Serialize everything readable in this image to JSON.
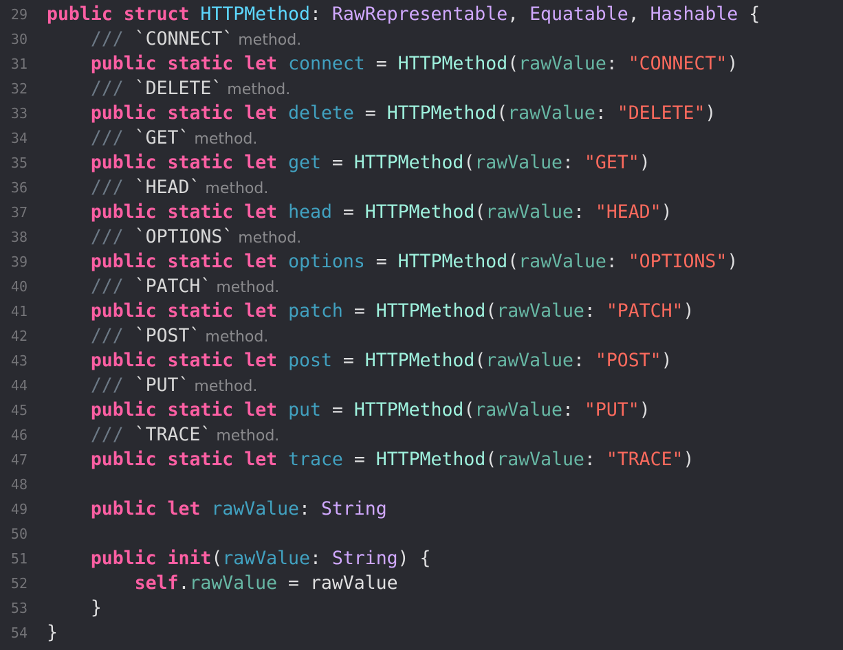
{
  "editor": {
    "background": "#292a30",
    "colors": {
      "keyword": "#fc5fa3",
      "type_declaration": "#5dd8ff",
      "type": "#d0a8ff",
      "project_type": "#9ef1dd",
      "project_member": "#67b7a4",
      "declaration": "#41a1c0",
      "string": "#fc6a5d",
      "plain": "#dfdfe0",
      "comment": "#6c7986",
      "line_number": "#747478"
    },
    "lines": [
      {
        "num": "29",
        "tokens": [
          {
            "t": "public",
            "c": "kw"
          },
          {
            "t": " ",
            "c": "plain"
          },
          {
            "t": "struct",
            "c": "kw"
          },
          {
            "t": " ",
            "c": "plain"
          },
          {
            "t": "HTTPMethod",
            "c": "typeDecl"
          },
          {
            "t": ": ",
            "c": "plain"
          },
          {
            "t": "RawRepresentable",
            "c": "type"
          },
          {
            "t": ", ",
            "c": "plain"
          },
          {
            "t": "Equatable",
            "c": "type"
          },
          {
            "t": ", ",
            "c": "plain"
          },
          {
            "t": "Hashable",
            "c": "type"
          },
          {
            "t": " {",
            "c": "plain"
          }
        ]
      },
      {
        "num": "30",
        "tokens": [
          {
            "t": "    ",
            "c": "plain"
          },
          {
            "t": "/// ",
            "c": "cmt"
          },
          {
            "t": "`CONNECT`",
            "c": "cmtcode"
          },
          {
            "t": " method.",
            "c": "cmttext"
          }
        ]
      },
      {
        "num": "31",
        "tokens": [
          {
            "t": "    ",
            "c": "plain"
          },
          {
            "t": "public",
            "c": "kw"
          },
          {
            "t": " ",
            "c": "plain"
          },
          {
            "t": "static",
            "c": "kw"
          },
          {
            "t": " ",
            "c": "plain"
          },
          {
            "t": "let",
            "c": "kw"
          },
          {
            "t": " ",
            "c": "plain"
          },
          {
            "t": "connect",
            "c": "declName"
          },
          {
            "t": " = ",
            "c": "plain"
          },
          {
            "t": "HTTPMethod",
            "c": "projType"
          },
          {
            "t": "(",
            "c": "plain"
          },
          {
            "t": "rawValue",
            "c": "projMember"
          },
          {
            "t": ": ",
            "c": "plain"
          },
          {
            "t": "\"CONNECT\"",
            "c": "str"
          },
          {
            "t": ")",
            "c": "plain"
          }
        ]
      },
      {
        "num": "32",
        "tokens": [
          {
            "t": "    ",
            "c": "plain"
          },
          {
            "t": "/// ",
            "c": "cmt"
          },
          {
            "t": "`DELETE`",
            "c": "cmtcode"
          },
          {
            "t": " method.",
            "c": "cmttext"
          }
        ]
      },
      {
        "num": "33",
        "tokens": [
          {
            "t": "    ",
            "c": "plain"
          },
          {
            "t": "public",
            "c": "kw"
          },
          {
            "t": " ",
            "c": "plain"
          },
          {
            "t": "static",
            "c": "kw"
          },
          {
            "t": " ",
            "c": "plain"
          },
          {
            "t": "let",
            "c": "kw"
          },
          {
            "t": " ",
            "c": "plain"
          },
          {
            "t": "delete",
            "c": "declName"
          },
          {
            "t": " = ",
            "c": "plain"
          },
          {
            "t": "HTTPMethod",
            "c": "projType"
          },
          {
            "t": "(",
            "c": "plain"
          },
          {
            "t": "rawValue",
            "c": "projMember"
          },
          {
            "t": ": ",
            "c": "plain"
          },
          {
            "t": "\"DELETE\"",
            "c": "str"
          },
          {
            "t": ")",
            "c": "plain"
          }
        ]
      },
      {
        "num": "34",
        "tokens": [
          {
            "t": "    ",
            "c": "plain"
          },
          {
            "t": "/// ",
            "c": "cmt"
          },
          {
            "t": "`GET`",
            "c": "cmtcode"
          },
          {
            "t": " method.",
            "c": "cmttext"
          }
        ]
      },
      {
        "num": "35",
        "tokens": [
          {
            "t": "    ",
            "c": "plain"
          },
          {
            "t": "public",
            "c": "kw"
          },
          {
            "t": " ",
            "c": "plain"
          },
          {
            "t": "static",
            "c": "kw"
          },
          {
            "t": " ",
            "c": "plain"
          },
          {
            "t": "let",
            "c": "kw"
          },
          {
            "t": " ",
            "c": "plain"
          },
          {
            "t": "get",
            "c": "declName"
          },
          {
            "t": " = ",
            "c": "plain"
          },
          {
            "t": "HTTPMethod",
            "c": "projType"
          },
          {
            "t": "(",
            "c": "plain"
          },
          {
            "t": "rawValue",
            "c": "projMember"
          },
          {
            "t": ": ",
            "c": "plain"
          },
          {
            "t": "\"GET\"",
            "c": "str"
          },
          {
            "t": ")",
            "c": "plain"
          }
        ]
      },
      {
        "num": "36",
        "tokens": [
          {
            "t": "    ",
            "c": "plain"
          },
          {
            "t": "/// ",
            "c": "cmt"
          },
          {
            "t": "`HEAD`",
            "c": "cmtcode"
          },
          {
            "t": " method.",
            "c": "cmttext"
          }
        ]
      },
      {
        "num": "37",
        "tokens": [
          {
            "t": "    ",
            "c": "plain"
          },
          {
            "t": "public",
            "c": "kw"
          },
          {
            "t": " ",
            "c": "plain"
          },
          {
            "t": "static",
            "c": "kw"
          },
          {
            "t": " ",
            "c": "plain"
          },
          {
            "t": "let",
            "c": "kw"
          },
          {
            "t": " ",
            "c": "plain"
          },
          {
            "t": "head",
            "c": "declName"
          },
          {
            "t": " = ",
            "c": "plain"
          },
          {
            "t": "HTTPMethod",
            "c": "projType"
          },
          {
            "t": "(",
            "c": "plain"
          },
          {
            "t": "rawValue",
            "c": "projMember"
          },
          {
            "t": ": ",
            "c": "plain"
          },
          {
            "t": "\"HEAD\"",
            "c": "str"
          },
          {
            "t": ")",
            "c": "plain"
          }
        ]
      },
      {
        "num": "38",
        "tokens": [
          {
            "t": "    ",
            "c": "plain"
          },
          {
            "t": "/// ",
            "c": "cmt"
          },
          {
            "t": "`OPTIONS`",
            "c": "cmtcode"
          },
          {
            "t": " method.",
            "c": "cmttext"
          }
        ]
      },
      {
        "num": "39",
        "tokens": [
          {
            "t": "    ",
            "c": "plain"
          },
          {
            "t": "public",
            "c": "kw"
          },
          {
            "t": " ",
            "c": "plain"
          },
          {
            "t": "static",
            "c": "kw"
          },
          {
            "t": " ",
            "c": "plain"
          },
          {
            "t": "let",
            "c": "kw"
          },
          {
            "t": " ",
            "c": "plain"
          },
          {
            "t": "options",
            "c": "declName"
          },
          {
            "t": " = ",
            "c": "plain"
          },
          {
            "t": "HTTPMethod",
            "c": "projType"
          },
          {
            "t": "(",
            "c": "plain"
          },
          {
            "t": "rawValue",
            "c": "projMember"
          },
          {
            "t": ": ",
            "c": "plain"
          },
          {
            "t": "\"OPTIONS\"",
            "c": "str"
          },
          {
            "t": ")",
            "c": "plain"
          }
        ]
      },
      {
        "num": "40",
        "tokens": [
          {
            "t": "    ",
            "c": "plain"
          },
          {
            "t": "/// ",
            "c": "cmt"
          },
          {
            "t": "`PATCH`",
            "c": "cmtcode"
          },
          {
            "t": " method.",
            "c": "cmttext"
          }
        ]
      },
      {
        "num": "41",
        "tokens": [
          {
            "t": "    ",
            "c": "plain"
          },
          {
            "t": "public",
            "c": "kw"
          },
          {
            "t": " ",
            "c": "plain"
          },
          {
            "t": "static",
            "c": "kw"
          },
          {
            "t": " ",
            "c": "plain"
          },
          {
            "t": "let",
            "c": "kw"
          },
          {
            "t": " ",
            "c": "plain"
          },
          {
            "t": "patch",
            "c": "declName"
          },
          {
            "t": " = ",
            "c": "plain"
          },
          {
            "t": "HTTPMethod",
            "c": "projType"
          },
          {
            "t": "(",
            "c": "plain"
          },
          {
            "t": "rawValue",
            "c": "projMember"
          },
          {
            "t": ": ",
            "c": "plain"
          },
          {
            "t": "\"PATCH\"",
            "c": "str"
          },
          {
            "t": ")",
            "c": "plain"
          }
        ]
      },
      {
        "num": "42",
        "tokens": [
          {
            "t": "    ",
            "c": "plain"
          },
          {
            "t": "/// ",
            "c": "cmt"
          },
          {
            "t": "`POST`",
            "c": "cmtcode"
          },
          {
            "t": " method.",
            "c": "cmttext"
          }
        ]
      },
      {
        "num": "43",
        "tokens": [
          {
            "t": "    ",
            "c": "plain"
          },
          {
            "t": "public",
            "c": "kw"
          },
          {
            "t": " ",
            "c": "plain"
          },
          {
            "t": "static",
            "c": "kw"
          },
          {
            "t": " ",
            "c": "plain"
          },
          {
            "t": "let",
            "c": "kw"
          },
          {
            "t": " ",
            "c": "plain"
          },
          {
            "t": "post",
            "c": "declName"
          },
          {
            "t": " = ",
            "c": "plain"
          },
          {
            "t": "HTTPMethod",
            "c": "projType"
          },
          {
            "t": "(",
            "c": "plain"
          },
          {
            "t": "rawValue",
            "c": "projMember"
          },
          {
            "t": ": ",
            "c": "plain"
          },
          {
            "t": "\"POST\"",
            "c": "str"
          },
          {
            "t": ")",
            "c": "plain"
          }
        ]
      },
      {
        "num": "44",
        "tokens": [
          {
            "t": "    ",
            "c": "plain"
          },
          {
            "t": "/// ",
            "c": "cmt"
          },
          {
            "t": "`PUT`",
            "c": "cmtcode"
          },
          {
            "t": " method.",
            "c": "cmttext"
          }
        ]
      },
      {
        "num": "45",
        "tokens": [
          {
            "t": "    ",
            "c": "plain"
          },
          {
            "t": "public",
            "c": "kw"
          },
          {
            "t": " ",
            "c": "plain"
          },
          {
            "t": "static",
            "c": "kw"
          },
          {
            "t": " ",
            "c": "plain"
          },
          {
            "t": "let",
            "c": "kw"
          },
          {
            "t": " ",
            "c": "plain"
          },
          {
            "t": "put",
            "c": "declName"
          },
          {
            "t": " = ",
            "c": "plain"
          },
          {
            "t": "HTTPMethod",
            "c": "projType"
          },
          {
            "t": "(",
            "c": "plain"
          },
          {
            "t": "rawValue",
            "c": "projMember"
          },
          {
            "t": ": ",
            "c": "plain"
          },
          {
            "t": "\"PUT\"",
            "c": "str"
          },
          {
            "t": ")",
            "c": "plain"
          }
        ]
      },
      {
        "num": "46",
        "tokens": [
          {
            "t": "    ",
            "c": "plain"
          },
          {
            "t": "/// ",
            "c": "cmt"
          },
          {
            "t": "`TRACE`",
            "c": "cmtcode"
          },
          {
            "t": " method.",
            "c": "cmttext"
          }
        ]
      },
      {
        "num": "47",
        "tokens": [
          {
            "t": "    ",
            "c": "plain"
          },
          {
            "t": "public",
            "c": "kw"
          },
          {
            "t": " ",
            "c": "plain"
          },
          {
            "t": "static",
            "c": "kw"
          },
          {
            "t": " ",
            "c": "plain"
          },
          {
            "t": "let",
            "c": "kw"
          },
          {
            "t": " ",
            "c": "plain"
          },
          {
            "t": "trace",
            "c": "declName"
          },
          {
            "t": " = ",
            "c": "plain"
          },
          {
            "t": "HTTPMethod",
            "c": "projType"
          },
          {
            "t": "(",
            "c": "plain"
          },
          {
            "t": "rawValue",
            "c": "projMember"
          },
          {
            "t": ": ",
            "c": "plain"
          },
          {
            "t": "\"TRACE\"",
            "c": "str"
          },
          {
            "t": ")",
            "c": "plain"
          }
        ]
      },
      {
        "num": "48",
        "tokens": []
      },
      {
        "num": "49",
        "tokens": [
          {
            "t": "    ",
            "c": "plain"
          },
          {
            "t": "public",
            "c": "kw"
          },
          {
            "t": " ",
            "c": "plain"
          },
          {
            "t": "let",
            "c": "kw"
          },
          {
            "t": " ",
            "c": "plain"
          },
          {
            "t": "rawValue",
            "c": "declName"
          },
          {
            "t": ": ",
            "c": "plain"
          },
          {
            "t": "String",
            "c": "type"
          }
        ]
      },
      {
        "num": "50",
        "tokens": []
      },
      {
        "num": "51",
        "tokens": [
          {
            "t": "    ",
            "c": "plain"
          },
          {
            "t": "public",
            "c": "kw"
          },
          {
            "t": " ",
            "c": "plain"
          },
          {
            "t": "init",
            "c": "kw"
          },
          {
            "t": "(",
            "c": "plain"
          },
          {
            "t": "rawValue",
            "c": "declName"
          },
          {
            "t": ": ",
            "c": "plain"
          },
          {
            "t": "String",
            "c": "type"
          },
          {
            "t": ") {",
            "c": "plain"
          }
        ]
      },
      {
        "num": "52",
        "tokens": [
          {
            "t": "        ",
            "c": "plain"
          },
          {
            "t": "self",
            "c": "kw"
          },
          {
            "t": ".",
            "c": "plain"
          },
          {
            "t": "rawValue",
            "c": "projMember"
          },
          {
            "t": " = rawValue",
            "c": "plain"
          }
        ]
      },
      {
        "num": "53",
        "tokens": [
          {
            "t": "    }",
            "c": "plain"
          }
        ]
      },
      {
        "num": "54",
        "tokens": [
          {
            "t": "}",
            "c": "plain"
          }
        ]
      }
    ]
  }
}
